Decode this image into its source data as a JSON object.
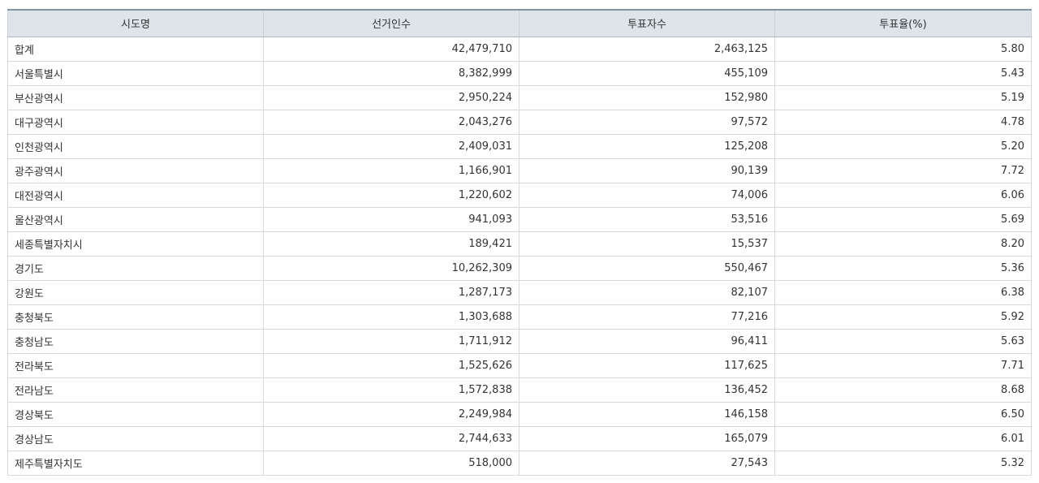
{
  "table": {
    "headers": [
      "시도명",
      "선거인수",
      "투표자수",
      "투표율(%)"
    ],
    "rows": [
      [
        "합계",
        "42,479,710",
        "2,463,125",
        "5.80"
      ],
      [
        "서울특별시",
        "8,382,999",
        "455,109",
        "5.43"
      ],
      [
        "부산광역시",
        "2,950,224",
        "152,980",
        "5.19"
      ],
      [
        "대구광역시",
        "2,043,276",
        "97,572",
        "4.78"
      ],
      [
        "인천광역시",
        "2,409,031",
        "125,208",
        "5.20"
      ],
      [
        "광주광역시",
        "1,166,901",
        "90,139",
        "7.72"
      ],
      [
        "대전광역시",
        "1,220,602",
        "74,006",
        "6.06"
      ],
      [
        "울산광역시",
        "941,093",
        "53,516",
        "5.69"
      ],
      [
        "세종특별자치시",
        "189,421",
        "15,537",
        "8.20"
      ],
      [
        "경기도",
        "10,262,309",
        "550,467",
        "5.36"
      ],
      [
        "강원도",
        "1,287,173",
        "82,107",
        "6.38"
      ],
      [
        "충청북도",
        "1,303,688",
        "77,216",
        "5.92"
      ],
      [
        "충청남도",
        "1,711,912",
        "96,411",
        "5.63"
      ],
      [
        "전라북도",
        "1,525,626",
        "117,625",
        "7.71"
      ],
      [
        "전라남도",
        "1,572,838",
        "136,452",
        "8.68"
      ],
      [
        "경상북도",
        "2,249,984",
        "146,158",
        "6.50"
      ],
      [
        "경상남도",
        "2,744,633",
        "165,079",
        "6.01"
      ],
      [
        "제주특별자치도",
        "518,000",
        "27,543",
        "5.32"
      ]
    ]
  }
}
